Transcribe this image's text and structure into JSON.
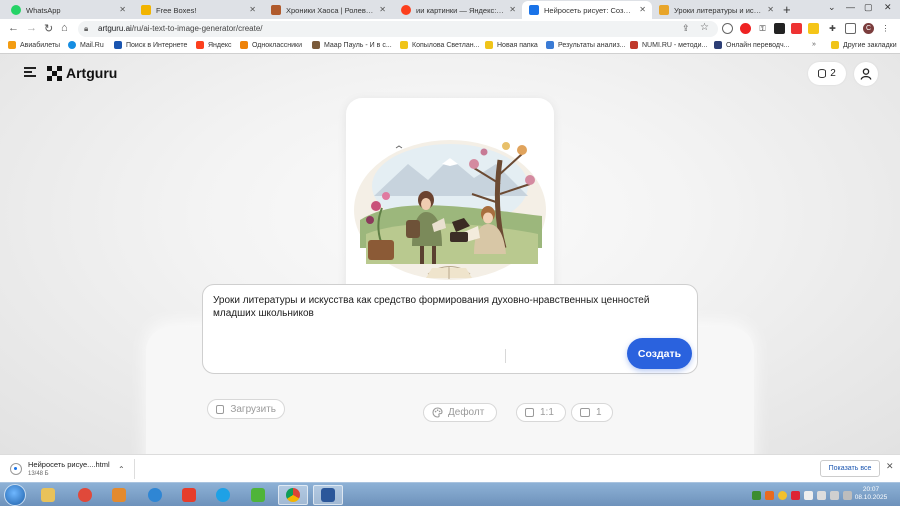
{
  "browser": {
    "tabs": [
      {
        "label": "WhatsApp",
        "icon": "whatsapp-icon",
        "color": "#25d366"
      },
      {
        "label": "Free Boxes!",
        "icon": "star-icon",
        "color": "#f2b400"
      },
      {
        "label": "Хроники Хаоса | Ролевая онл...",
        "icon": "game-icon",
        "color": "#b05a2c"
      },
      {
        "label": "ии картинки — Яндекс: нашл...",
        "icon": "yandex-icon",
        "color": "#fc3f1d"
      },
      {
        "label": "Нейросеть рисует: Создание...",
        "icon": "artguru-icon",
        "color": "#1a73e8",
        "active": true
      },
      {
        "label": "Уроки литературы и искусств...",
        "icon": "school-icon",
        "color": "#e8a52a"
      }
    ],
    "url_domain": "artguru.ai",
    "url_path": "/ru/ai-text-to-image-generator/create/",
    "bookmarks": [
      {
        "label": "Авиабилеты",
        "icon": "plane-icon",
        "color": "#f39c12"
      },
      {
        "label": "Mail.Ru",
        "icon": "mail-icon",
        "color": "#168de2"
      },
      {
        "label": "Поиск в Интернете",
        "icon": "search-icon",
        "color": "#1a55b0"
      },
      {
        "label": "Яндекс",
        "icon": "yandex-icon",
        "color": "#fc3f1d"
      },
      {
        "label": "Одноклассники",
        "icon": "ok-icon",
        "color": "#ee8208"
      },
      {
        "label": "Маар Пауль - И в с...",
        "icon": "book-icon",
        "color": "#7a5a3a"
      },
      {
        "label": "Копылова Светлан...",
        "icon": "folder-icon",
        "color": "#f0c419"
      },
      {
        "label": "Новая папка",
        "icon": "folder-icon",
        "color": "#f0c419"
      },
      {
        "label": "Результаты анализ...",
        "icon": "mountain-icon",
        "color": "#3a7bd5"
      },
      {
        "label": "NUMI.RU - методи...",
        "icon": "numi-icon",
        "color": "#c0392b"
      },
      {
        "label": "Онлайн переводч...",
        "icon": "translate-icon",
        "color": "#2c3e75"
      },
      {
        "label": "Другие закладки",
        "icon": "folder-icon",
        "color": "#f0c419"
      }
    ]
  },
  "app": {
    "logo_text": "Artguru",
    "credits": "2"
  },
  "prompt": {
    "text": "Уроки литературы и искусства как средство формирования духовно-нравственных ценностей младших школьников",
    "upload_label": "Загрузить",
    "style_label": "Дефолт",
    "ratio_label": "1:1",
    "count_label": "1",
    "create_label": "Создать"
  },
  "downloads": {
    "file_name": "Нейросеть рисуе....html",
    "file_size": "13/48 Б",
    "show_all_label": "Показать все"
  },
  "taskbar": {
    "time": "20:07",
    "date": "08.10.2025"
  }
}
